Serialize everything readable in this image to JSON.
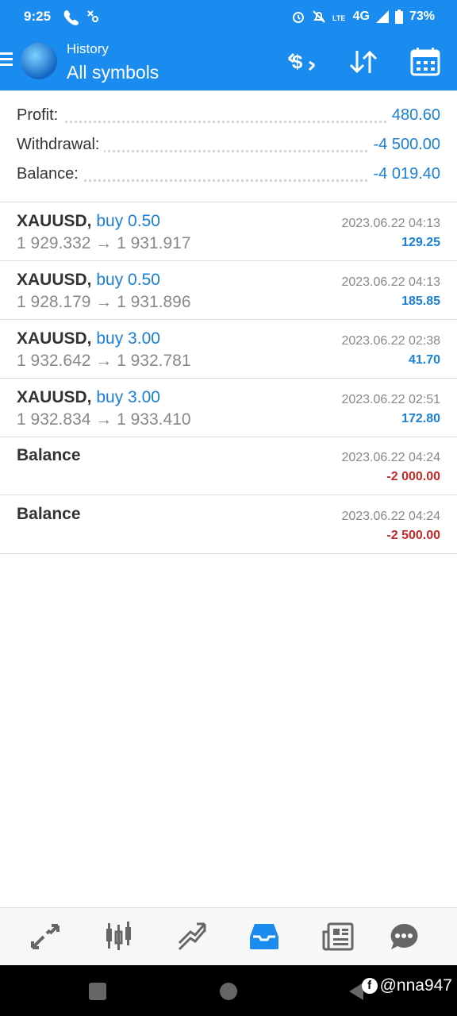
{
  "status_bar": {
    "time": "9:25",
    "network": "4G",
    "battery": "73%",
    "icons": [
      "call-icon",
      "sync-icon",
      "alarm-icon",
      "mute-icon",
      "lte-icon",
      "signal-icon",
      "battery-icon"
    ]
  },
  "header": {
    "subtitle": "History",
    "title": "All symbols",
    "icons": [
      "menu-icon",
      "logo-icon",
      "deposit-icon",
      "sort-icon",
      "calendar-icon"
    ]
  },
  "summary": {
    "profit_label": "Profit:",
    "profit_value": "480.60",
    "withdrawal_label": "Withdrawal:",
    "withdrawal_value": "-4 500.00",
    "balance_label": "Balance:",
    "balance_value": "-4 019.40"
  },
  "deals": [
    {
      "symbol": "XAUUSD,",
      "type": "buy 0.50",
      "prices": "1 929.332 → 1 931.917",
      "time": "2023.06.22 04:13",
      "profit": "129.25",
      "profit_color": "#1a7fd6"
    },
    {
      "symbol": "XAUUSD,",
      "type": "buy 0.50",
      "prices": "1 928.179 → 1 931.896",
      "time": "2023.06.22 04:13",
      "profit": "185.85",
      "profit_color": "#1a7fd6"
    },
    {
      "symbol": "XAUUSD,",
      "type": "buy 3.00",
      "prices": "1 932.642 → 1 932.781",
      "time": "2023.06.22 02:38",
      "profit": "41.70",
      "profit_color": "#1a7fd6"
    },
    {
      "symbol": "XAUUSD,",
      "type": "buy 3.00",
      "prices": "1 932.834 → 1 933.410",
      "time": "2023.06.22 02:51",
      "profit": "172.80",
      "profit_color": "#1a7fd6"
    },
    {
      "symbol": "Balance",
      "type": "",
      "prices": "",
      "time": "2023.06.22 04:24",
      "profit": "-2 000.00",
      "profit_color": "#c62828"
    },
    {
      "symbol": "Balance",
      "type": "",
      "prices": "",
      "time": "2023.06.22 04:24",
      "profit": "-2 500.00",
      "profit_color": "#c62828"
    }
  ],
  "bottom_nav": [
    "quotes-icon",
    "chart-icon",
    "trade-icon",
    "history-icon",
    "news-icon",
    "chat-icon"
  ],
  "bottom_nav_active": "history-icon",
  "watermark": "@nna947",
  "colors": {
    "accent": "#1a8cf0",
    "positive": "#1a7fd6",
    "negative": "#c62828"
  }
}
